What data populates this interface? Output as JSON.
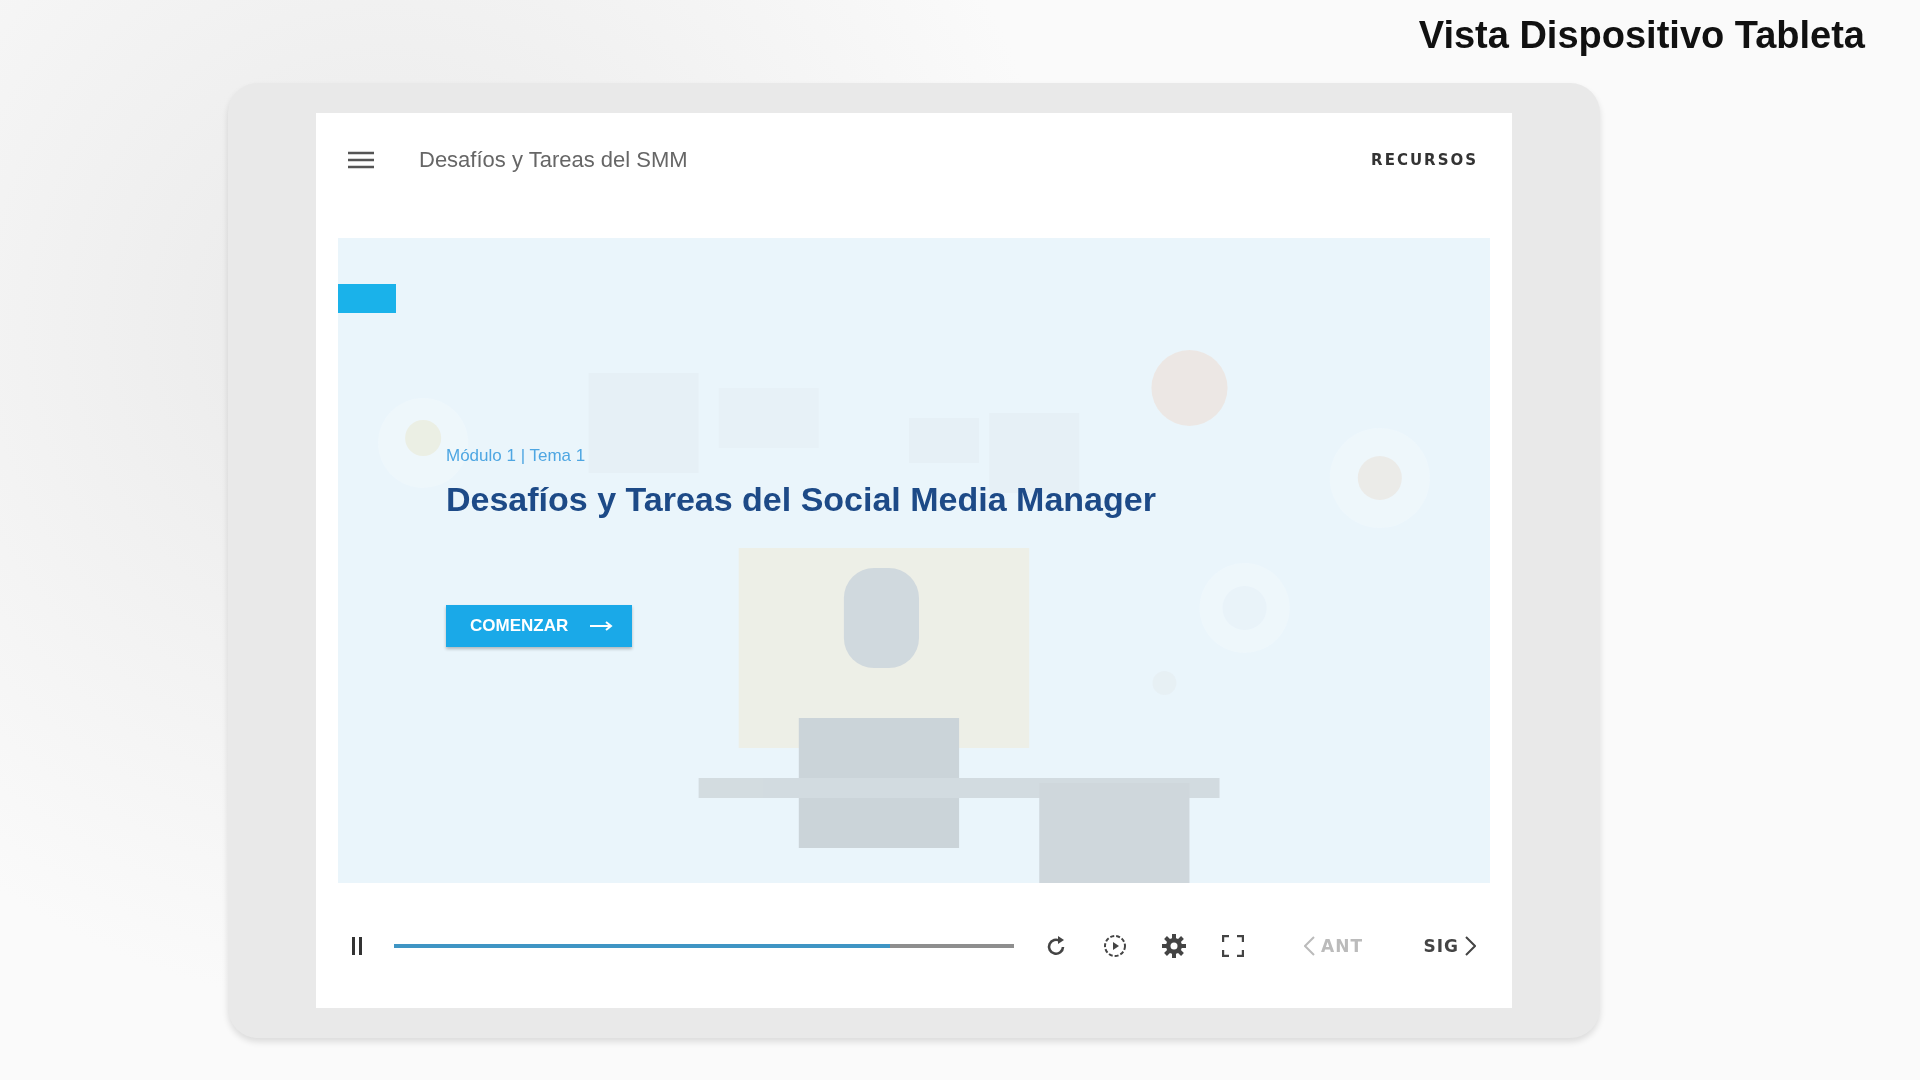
{
  "slide_title": "Vista Dispositivo Tableta",
  "header": {
    "title": "Desafíos y Tareas del SMM",
    "resources": "RECURSOS"
  },
  "hero": {
    "subtitle": "Módulo 1 | Tema 1",
    "heading": "Desafíos y Tareas del Social Media Manager",
    "start_button": "COMENZAR"
  },
  "player": {
    "progress": {
      "level": 0.8
    },
    "prev": {
      "label": "ANT",
      "disabled": true
    },
    "next": {
      "label": "SIG",
      "disabled": false
    }
  }
}
